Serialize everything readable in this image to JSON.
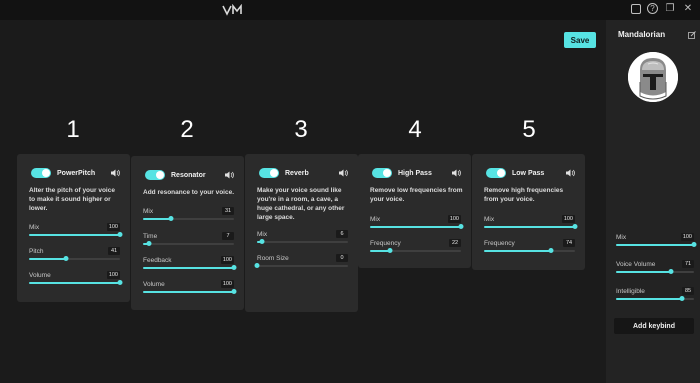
{
  "window": {
    "logo_icon": "vm-logo-icon",
    "icons": [
      "snapshot-icon",
      "help-icon",
      "restore-icon",
      "close-icon"
    ]
  },
  "toolbar": {
    "save_label": "Save"
  },
  "accent_color": "#57e3e3",
  "steps": [
    "1",
    "2",
    "3",
    "4",
    "5"
  ],
  "effects": [
    {
      "title": "PowerPitch",
      "enabled": true,
      "description": "Alter the pitch of your voice to make it sound higher or lower.",
      "params": [
        {
          "label": "Mix",
          "value": "100",
          "level": 100
        },
        {
          "label": "Pitch",
          "value": "41",
          "level": 41
        },
        {
          "label": "Volume",
          "value": "100",
          "level": 100
        }
      ]
    },
    {
      "title": "Resonator",
      "enabled": true,
      "description": "Add resonance to your voice.",
      "params": [
        {
          "label": "Mix",
          "value": "31",
          "level": 31
        },
        {
          "label": "Time",
          "value": "7",
          "level": 7
        },
        {
          "label": "Feedback",
          "value": "100",
          "level": 100
        },
        {
          "label": "Volume",
          "value": "100",
          "level": 100
        }
      ]
    },
    {
      "title": "Reverb",
      "enabled": true,
      "description": "Make your voice sound like you're in a room, a cave, a huge cathedral, or any other large space.",
      "params": [
        {
          "label": "Mix",
          "value": "6",
          "level": 6
        },
        {
          "label": "Room Size",
          "value": "0",
          "level": 0
        }
      ]
    },
    {
      "title": "High Pass",
      "enabled": true,
      "description": "Remove low frequencies from your voice.",
      "params": [
        {
          "label": "Mix",
          "value": "100",
          "level": 100
        },
        {
          "label": "Frequency",
          "value": "22",
          "level": 22
        }
      ]
    },
    {
      "title": "Low Pass",
      "enabled": true,
      "description": "Remove high frequencies from your voice.",
      "params": [
        {
          "label": "Mix",
          "value": "100",
          "level": 100
        },
        {
          "label": "Frequency",
          "value": "74",
          "level": 74
        }
      ]
    }
  ],
  "sidebar": {
    "name": "Mandalorian",
    "params": [
      {
        "label": "Mix",
        "value": "100",
        "level": 100
      },
      {
        "label": "Voice Volume",
        "value": "71",
        "level": 71
      },
      {
        "label": "Intelligible",
        "value": "85",
        "level": 85
      }
    ],
    "add_keybind_label": "Add keybind"
  }
}
